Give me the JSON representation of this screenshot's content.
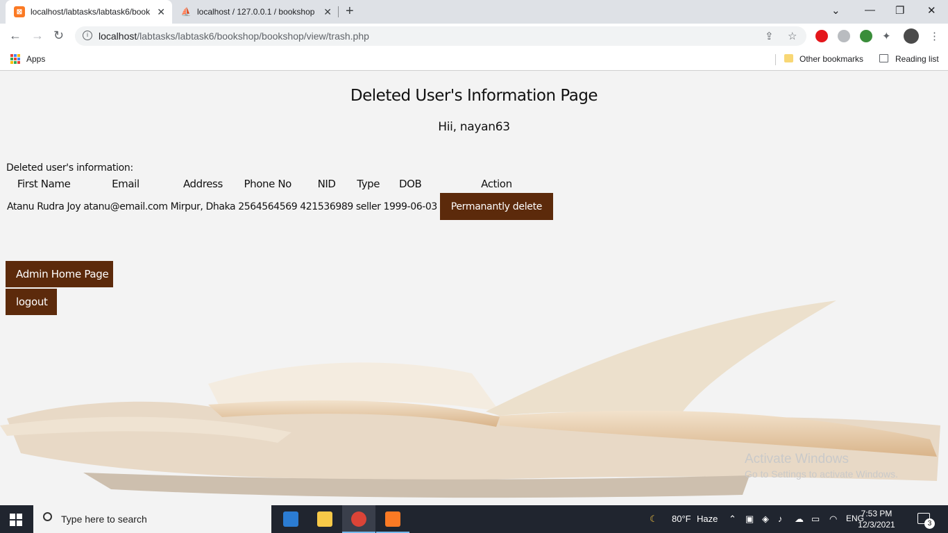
{
  "browser": {
    "tabs": [
      {
        "title": "localhost/labtasks/labtask6/book",
        "active": true,
        "favicon": "xampp-icon"
      },
      {
        "title": "localhost / 127.0.0.1 / bookshop",
        "active": false,
        "favicon": "phpmyadmin-icon"
      }
    ],
    "url_host": "localhost",
    "url_path": "/labtasks/labtask6/bookshop/bookshop/view/trash.php",
    "bookmarks": {
      "apps_label": "Apps",
      "other_label": "Other bookmarks",
      "reading_label": "Reading list"
    }
  },
  "page": {
    "title": "Deleted User's Information Page",
    "greeting": "Hii, nayan63",
    "section_label": "Deleted user's information:",
    "columns": [
      "First Name",
      "Email",
      "Address",
      "Phone No",
      "NID",
      "Type",
      "DOB",
      "Action"
    ],
    "rows": [
      {
        "first_name": "Atanu Rudra Joy",
        "email": "atanu@email.com",
        "address": "Mirpur, Dhaka",
        "phone": "2564564569",
        "nid": "421536989",
        "type": "seller",
        "dob": "1999-06-03",
        "action_label": "Permanantly delete"
      }
    ],
    "admin_home_label": "Admin Home Page",
    "logout_label": "logout",
    "accent_color": "#5c2a0b"
  },
  "watermark": {
    "line1": "Activate Windows",
    "line2": "Go to Settings to activate Windows."
  },
  "taskbar": {
    "search_placeholder": "Type here to search",
    "weather_temp": "80°F",
    "weather_desc": "Haze",
    "language": "ENG",
    "time": "7:53 PM",
    "date": "12/3/2021",
    "notifications": "3"
  }
}
